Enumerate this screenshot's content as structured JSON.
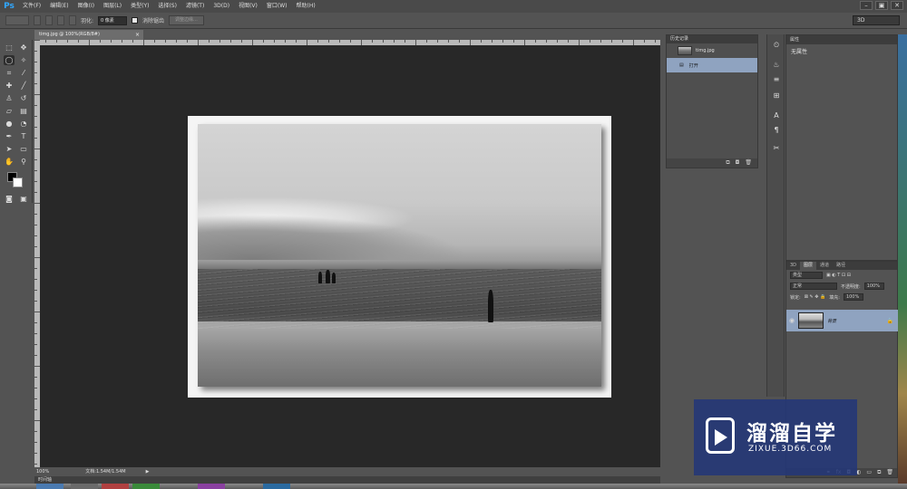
{
  "app": {
    "logo": "Ps"
  },
  "menu": [
    "文件(F)",
    "编辑(E)",
    "图像(I)",
    "图层(L)",
    "类型(Y)",
    "选择(S)",
    "滤镜(T)",
    "3D(D)",
    "视图(V)",
    "窗口(W)",
    "帮助(H)"
  ],
  "window_controls": {
    "minimize": "–",
    "restore": "▣",
    "close": "✕"
  },
  "options": {
    "feather_label": "羽化:",
    "feather_value": "0 像素",
    "antialias_label": "消除锯齿",
    "refine_edge_button": "调整边缘...",
    "workspace": "3D"
  },
  "document": {
    "tab_title": "timg.jpg @ 100%(RGB/8#)",
    "tab_close": "×",
    "zoom": "100%",
    "doc_info": "文档:1.54M/1.54M",
    "status_arrow": "▶",
    "timeline_label": "时间轴"
  },
  "history": {
    "panel_title": "历史记录",
    "snapshot_name": "timg.jpg",
    "states": [
      "打开"
    ],
    "footer_icons": [
      "new-document-icon",
      "camera-icon",
      "trash-icon"
    ]
  },
  "properties": {
    "panel_title": "属性",
    "content": "无属性"
  },
  "layers": {
    "tabs": [
      "3D",
      "图层",
      "通道",
      "路径"
    ],
    "active_tab": "图层",
    "filter_kind": "类型",
    "blend_mode": "正常",
    "opacity_label": "不透明度:",
    "opacity_value": "100%",
    "lock_label": "锁定:",
    "fill_label": "填充:",
    "fill_value": "100%",
    "layer_name": "背景",
    "layer_lock_icon": "🔒"
  },
  "watermark": {
    "title": "溜溜自学",
    "url": "ZIXUE.3D66.COM"
  },
  "colors": {
    "ps_blue": "#31a8ff",
    "selection_blue": "#8fa3c0",
    "panel_bg": "#535353",
    "canvas_bg": "#282828"
  }
}
